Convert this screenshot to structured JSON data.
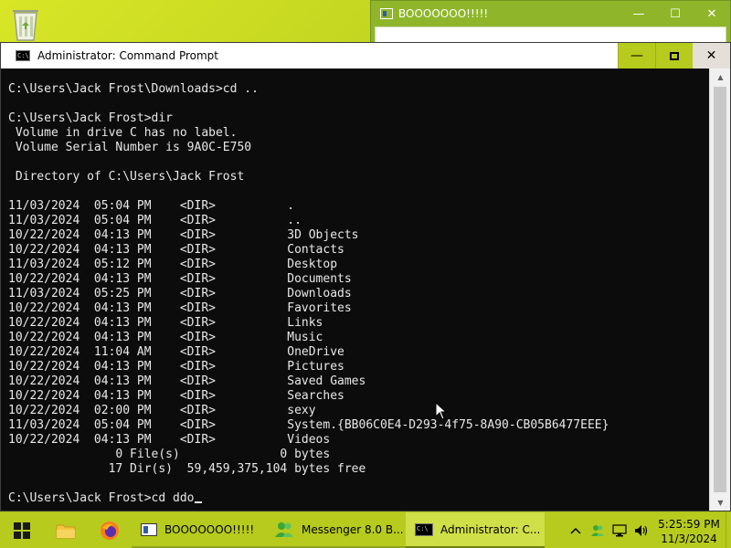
{
  "desktop": {
    "recycle_bin_icon": "recycle-bin-icon"
  },
  "background_window": {
    "title": "BOOOOOOO!!!!!",
    "minimize": "—",
    "maximize": "☐",
    "close": "✕"
  },
  "cmd_window": {
    "title": "Administrator: Command Prompt",
    "minimize": "—",
    "close": "✕"
  },
  "console": {
    "lines": [
      "C:\\Users\\Jack Frost\\Downloads>cd ..",
      "",
      "C:\\Users\\Jack Frost>dir",
      " Volume in drive C has no label.",
      " Volume Serial Number is 9A0C-E750",
      "",
      " Directory of C:\\Users\\Jack Frost",
      "",
      "11/03/2024  05:04 PM    <DIR>          .",
      "11/03/2024  05:04 PM    <DIR>          ..",
      "10/22/2024  04:13 PM    <DIR>          3D Objects",
      "10/22/2024  04:13 PM    <DIR>          Contacts",
      "11/03/2024  05:12 PM    <DIR>          Desktop",
      "10/22/2024  04:13 PM    <DIR>          Documents",
      "11/03/2024  05:25 PM    <DIR>          Downloads",
      "10/22/2024  04:13 PM    <DIR>          Favorites",
      "10/22/2024  04:13 PM    <DIR>          Links",
      "10/22/2024  04:13 PM    <DIR>          Music",
      "10/22/2024  11:04 AM    <DIR>          OneDrive",
      "10/22/2024  04:13 PM    <DIR>          Pictures",
      "10/22/2024  04:13 PM    <DIR>          Saved Games",
      "10/22/2024  04:13 PM    <DIR>          Searches",
      "10/22/2024  02:00 PM    <DIR>          sexy",
      "11/03/2024  05:04 PM    <DIR>          System.{BB06C0E4-D293-4f75-8A90-CB05B6477EEE}",
      "10/22/2024  04:13 PM    <DIR>          Videos",
      "               0 File(s)              0 bytes",
      "              17 Dir(s)  59,459,375,104 bytes free",
      ""
    ],
    "prompt": "C:\\Users\\Jack Frost>cd ddo"
  },
  "taskbar": {
    "tasks": [
      {
        "label": "BOOOOOOO!!!!!"
      },
      {
        "label": "Messenger 8.0 B..."
      },
      {
        "label": "Administrator: C..."
      }
    ],
    "clock_time": "5:25:59 PM",
    "clock_date": "11/3/2024"
  }
}
